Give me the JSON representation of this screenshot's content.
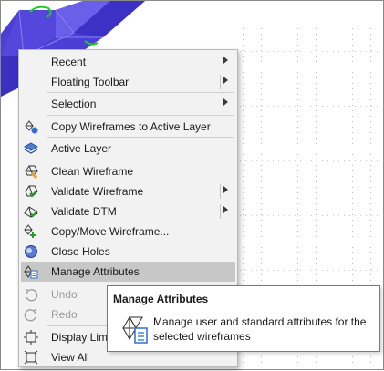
{
  "menu": {
    "items": [
      {
        "label": "Recent",
        "icon": "",
        "submenu": true,
        "split": false
      },
      {
        "label": "Floating Toolbar",
        "icon": "",
        "submenu": true,
        "split": true
      },
      {
        "label": "Selection",
        "icon": "",
        "submenu": true,
        "split": false
      },
      {
        "label": "Copy Wireframes to Active Layer",
        "icon": "copy-wireframes-layer-icon",
        "submenu": false,
        "split": false
      },
      {
        "label": "Active Layer",
        "icon": "layers-icon",
        "submenu": false,
        "split": false
      },
      {
        "label": "Clean Wireframe",
        "icon": "clean-wireframe-icon",
        "submenu": false,
        "split": false
      },
      {
        "label": "Validate Wireframe",
        "icon": "validate-wireframe-icon",
        "submenu": true,
        "split": true
      },
      {
        "label": "Validate DTM",
        "icon": "validate-dtm-icon",
        "submenu": true,
        "split": true
      },
      {
        "label": "Copy/Move Wireframe...",
        "icon": "copy-move-wireframe-icon",
        "submenu": false,
        "split": false
      },
      {
        "label": "Close Holes",
        "icon": "close-holes-icon",
        "submenu": false,
        "split": false
      },
      {
        "label": "Manage Attributes",
        "icon": "manage-attributes-icon",
        "submenu": false,
        "split": false,
        "highlighted": true
      },
      {
        "label": "Undo",
        "icon": "undo-icon",
        "submenu": false,
        "split": false,
        "disabled": true
      },
      {
        "label": "Redo",
        "icon": "redo-icon",
        "submenu": false,
        "split": false,
        "disabled": true
      },
      {
        "label": "Display Lim",
        "icon": "display-limits-icon",
        "submenu": false,
        "split": false
      },
      {
        "label": "View All",
        "icon": "view-all-icon",
        "submenu": false,
        "split": false
      }
    ]
  },
  "tooltip": {
    "title": "Manage Attributes",
    "description": "Manage user and standard attributes for the selected wireframes",
    "icon": "manage-attributes-icon"
  },
  "colors": {
    "wireframe": "#4b3fd6",
    "wireframe_highlight": "#7a6ff0",
    "selection": "#22cc22",
    "accent_icon": "#2f6fd0",
    "warning_icon": "#f0a020"
  }
}
